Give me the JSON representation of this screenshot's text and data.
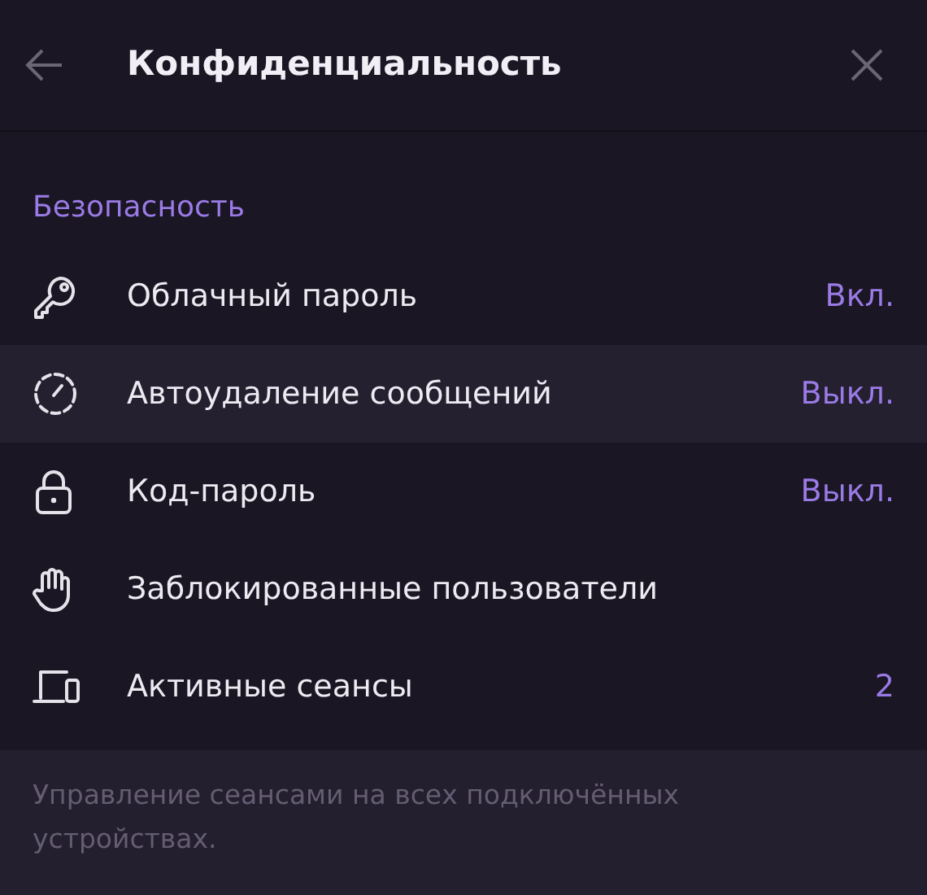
{
  "header": {
    "title": "Конфиденциальность"
  },
  "section": {
    "title": "Безопасность",
    "items": [
      {
        "label": "Облачный пароль",
        "value": "Вкл.",
        "highlighted": false
      },
      {
        "label": "Автоудаление сообщений",
        "value": "Выкл.",
        "highlighted": true
      },
      {
        "label": "Код-пароль",
        "value": "Выкл.",
        "highlighted": false
      },
      {
        "label": "Заблокированные пользователи",
        "highlighted": false
      },
      {
        "label": "Активные сеансы",
        "value": "2",
        "highlighted": false
      }
    ],
    "footnote": "Управление сеансами на всех подключённых устройствах."
  }
}
